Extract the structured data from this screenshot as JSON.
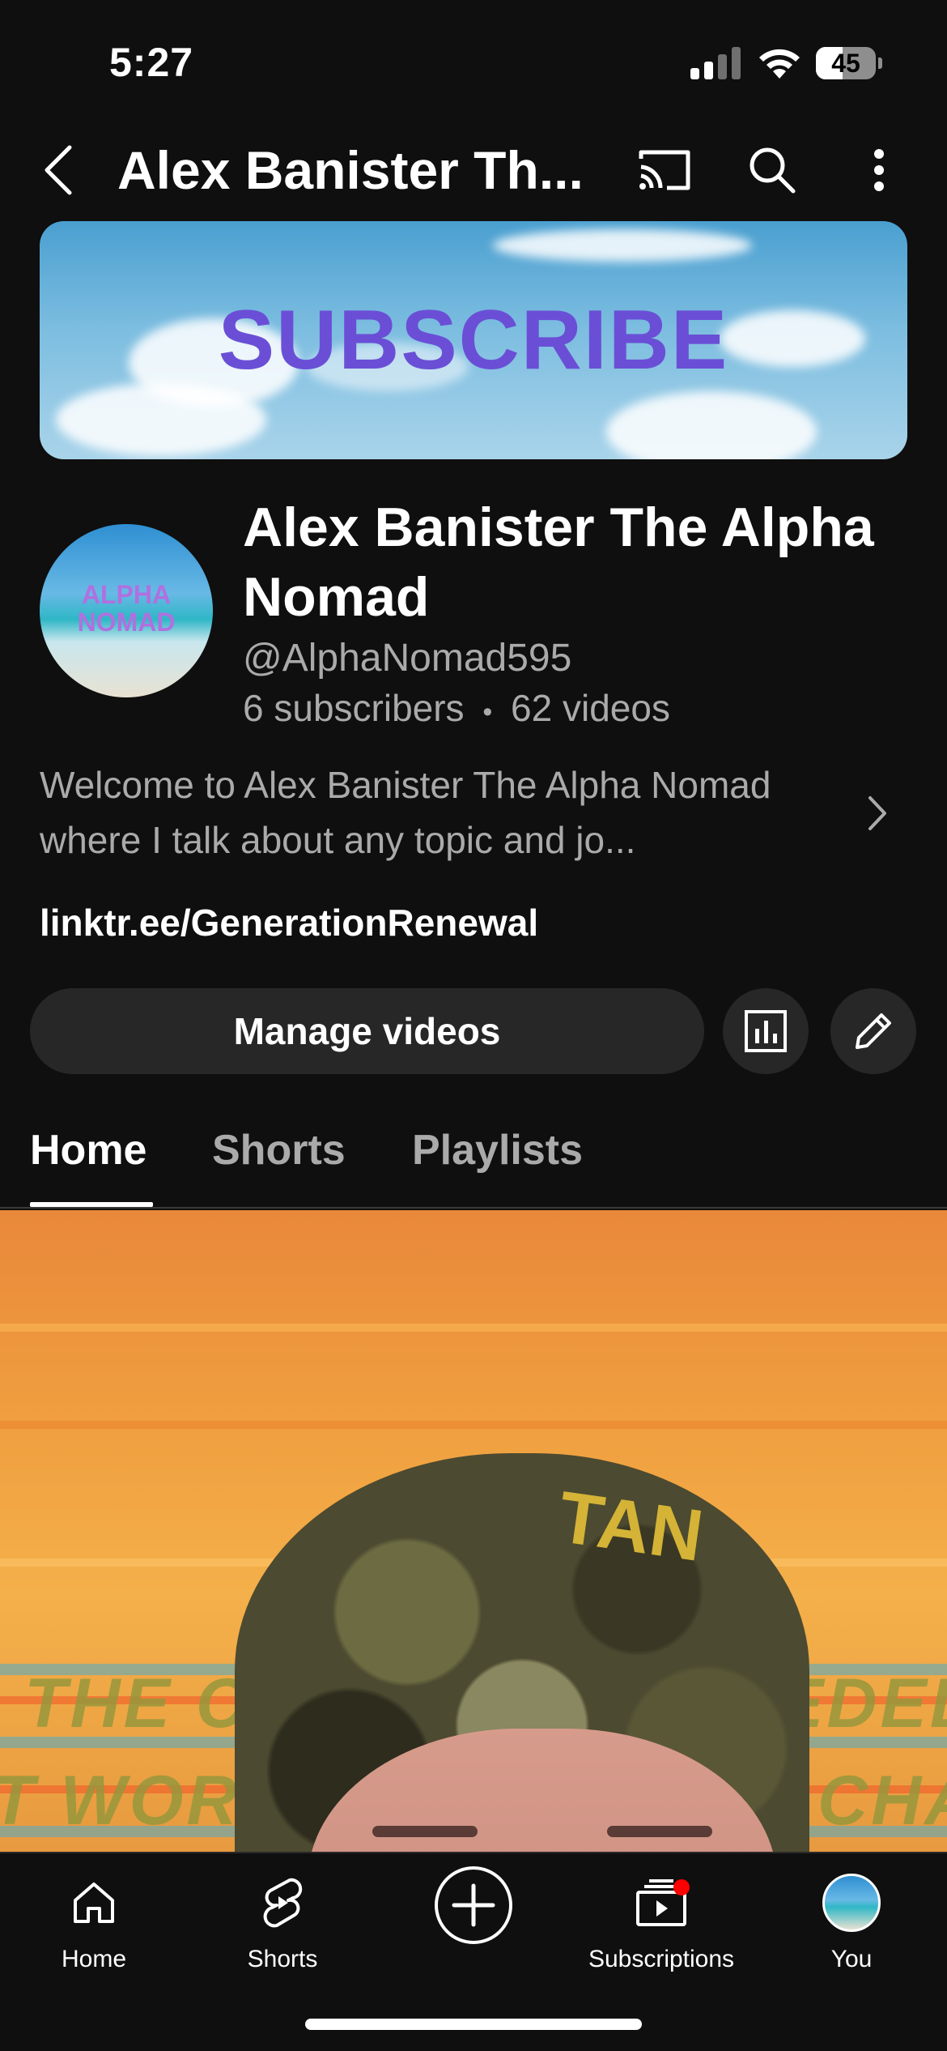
{
  "status_bar": {
    "time": "5:27",
    "battery": "45",
    "battery_level_percent": 45
  },
  "app_bar": {
    "title": "Alex Banister Th...",
    "icons": [
      "back-icon",
      "cast-icon",
      "search-icon",
      "more-vert-icon"
    ]
  },
  "banner": {
    "text": "SUBSCRIBE"
  },
  "channel": {
    "avatar_text_line1": "ALPHA",
    "avatar_text_line2": "NOMAD",
    "name": "Alex Banister The Alpha Nomad",
    "handle": "@AlphaNomad595",
    "subscribers": "6 subscribers",
    "separator": "•",
    "videos": "62 videos",
    "description": "Welcome to Alex Banister The Alpha Nomad where I talk about any topic and jo...",
    "link": "linktr.ee/GenerationRenewal"
  },
  "actions": {
    "manage_videos": "Manage videos",
    "icons": [
      "analytics-icon",
      "edit-icon"
    ]
  },
  "tabs": [
    {
      "label": "Home",
      "active": true
    },
    {
      "label": "Shorts",
      "active": false
    },
    {
      "label": "Playlists",
      "active": false
    }
  ],
  "video": {
    "hat_text": "TAN",
    "overlay_line1_left": "THE CA",
    "overlay_line1_right": "EDED",
    "overlay_line2_left": "T WORLD",
    "overlay_line2_right": "CHA"
  },
  "bottom_nav": {
    "items": [
      {
        "label": "Home",
        "icon": "home-icon"
      },
      {
        "label": "Shorts",
        "icon": "shorts-icon"
      },
      {
        "label": "",
        "icon": "create-icon"
      },
      {
        "label": "Subscriptions",
        "icon": "subscriptions-icon"
      },
      {
        "label": "You",
        "icon": "avatar"
      }
    ]
  },
  "colors": {
    "background": "#0f0f0f",
    "surface": "#272727",
    "secondary_text": "#aaaaaa",
    "notification_dot": "#ff0000"
  }
}
